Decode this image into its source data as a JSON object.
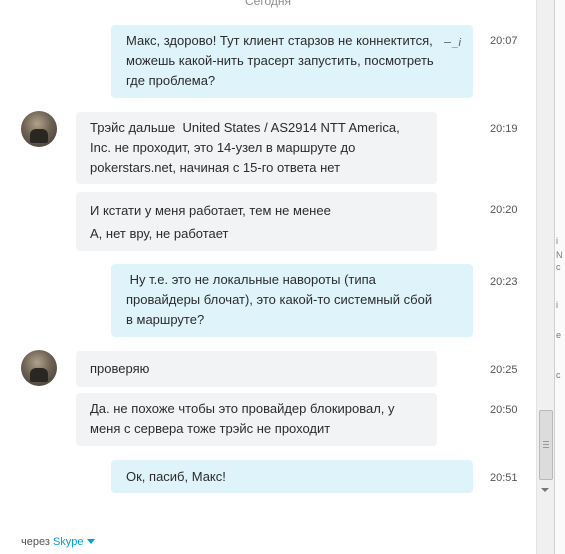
{
  "day_separator": "Сегодня",
  "messages": [
    {
      "direction": "out",
      "text": "Макс, здорово! Тут клиент старзов не коннектится,\nможешь какой-нить трасерт запустить, посмотреть\nгде проблема?",
      "time": "20:07",
      "edited_icon": "_i"
    },
    {
      "direction": "in",
      "avatar": true,
      "text": "Трэйс дальше  United States / AS2914 NTT America,\nInc. не проходит, это 14-узел в маршруте до\npokerstars.net, начиная с 15-го ответа нет",
      "time": "20:19"
    },
    {
      "direction": "in",
      "text": "И кстати у меня работает, тем не менее\nА, нет вру, не работает",
      "time": "20:20"
    },
    {
      "direction": "out",
      "text": " Ну т.е. это не локальные навороты (типа\nпровайдеры блочат), это какой-то системный сбой\nв маршруте?",
      "time": "20:23"
    },
    {
      "direction": "in",
      "avatar": true,
      "text": "проверяю",
      "time": "20:25"
    },
    {
      "direction": "in",
      "text": "Да. не похоже чтобы это провайдер блокировал, у\nменя с сервера тоже трэйс не проходит",
      "time": "20:50"
    },
    {
      "direction": "out",
      "text": "Ок, пасиб, Макс!",
      "time": "20:51"
    }
  ],
  "footer": {
    "prefix": "через",
    "service": "Skype"
  },
  "right_strip_chars": [
    "i",
    "N",
    "c",
    "i",
    "e",
    "c"
  ],
  "colors": {
    "outgoing_bubble": "#dff3fb",
    "incoming_bubble": "#f1f3f5",
    "link": "#00a1df"
  }
}
